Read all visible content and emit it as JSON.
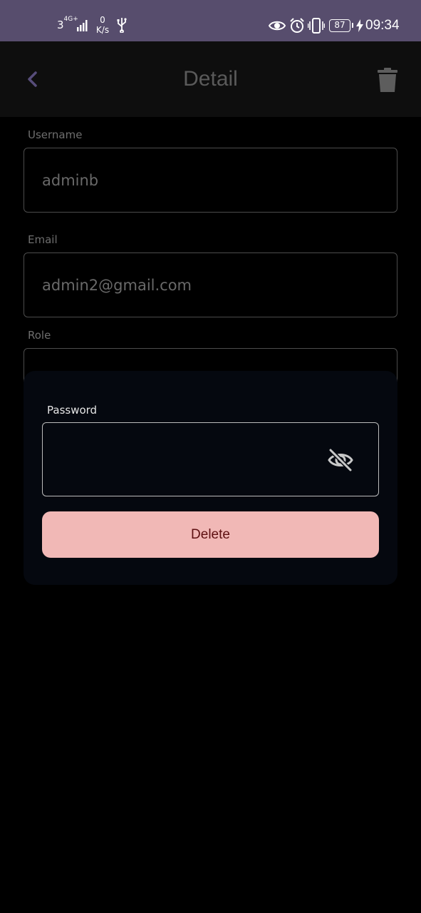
{
  "status_bar": {
    "network": "3",
    "network_type": "4G+",
    "speed_value": "0",
    "speed_unit": "K/s",
    "battery": "87",
    "time": "09:34",
    "icons": [
      "signal-bars-icon",
      "usb-icon",
      "eye-icon",
      "alarm-icon",
      "vibrate-icon",
      "battery-icon",
      "charging-bolt-icon"
    ]
  },
  "app_bar": {
    "title": "Detail",
    "back_icon": "chevron-left-icon",
    "delete_icon": "trash-icon"
  },
  "form": {
    "username": {
      "label": "Username",
      "value": "adminb"
    },
    "email": {
      "label": "Email",
      "value": "admin2@gmail.com"
    },
    "role": {
      "label": "Role",
      "value": ""
    }
  },
  "dialog": {
    "password_label": "Password",
    "password_value": "",
    "visibility_icon": "eye-off-icon",
    "delete_label": "Delete"
  },
  "colors": {
    "status_bar_bg": "#574d6d",
    "app_bar_bg": "#0e0e0e",
    "page_bg": "#000000",
    "dialog_bg": "#05080f",
    "delete_button_bg": "#f1b8b6",
    "delete_button_text": "#5e1012",
    "back_icon": "#574d7a"
  }
}
